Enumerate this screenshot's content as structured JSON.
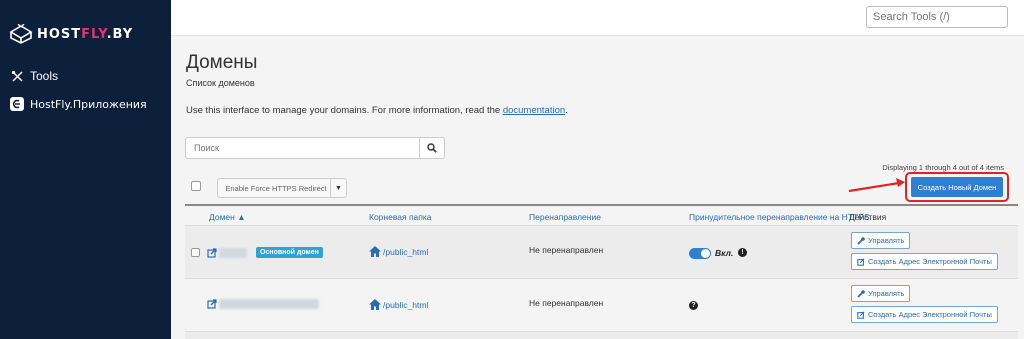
{
  "brand": {
    "logo_prefix": "HOST",
    "logo_accent": "FLY",
    "logo_suffix": ".BY"
  },
  "sidebar": {
    "items": [
      {
        "label": "Tools",
        "icon": "tools-icon"
      },
      {
        "label": "HostFly.Приложения",
        "icon": "app-icon"
      }
    ]
  },
  "topbar": {
    "search_placeholder": "Search Tools (/)"
  },
  "page": {
    "title": "Домены",
    "subtitle": "Список доменов",
    "info_text": "Use this interface to manage your domains. For more information, read the",
    "info_link": "documentation",
    "info_end": "."
  },
  "search": {
    "placeholder": "Поиск"
  },
  "toolbar": {
    "https_button": "Enable Force HTTPS Redirect",
    "displaying": "Displaying 1 through 4 out of 4 items",
    "create_button": "Создать Новый Домен"
  },
  "table": {
    "columns": {
      "domain": "Домен",
      "root": "Корневая папка",
      "redirect": "Перенаправление",
      "force": "Принудительное перенаправление на HTTPS",
      "actions": "Действия"
    },
    "rows": [
      {
        "badge": "Основной домен",
        "root": "/public_html",
        "redirect": "Не перенаправлен",
        "force_label": "Вкл.",
        "manage": "Управлять",
        "create_email": "Создать Адрес Электронной Почты"
      },
      {
        "root": "/public_html",
        "redirect": "Не перенаправлен",
        "manage": "Управлять",
        "create_email": "Создать Адрес Электронной Почты"
      }
    ]
  },
  "colors": {
    "sidebar_bg": "#0c1f3b",
    "accent": "#2f80d1",
    "brand_pink": "#e8326f",
    "highlight": "#e02424"
  }
}
